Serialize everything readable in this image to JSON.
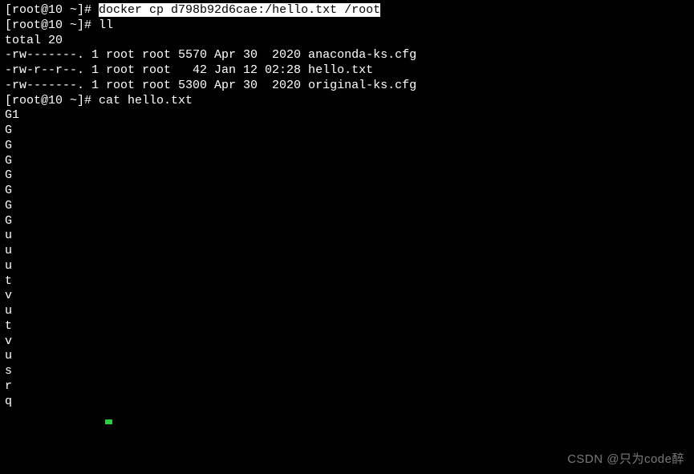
{
  "lines": [
    {
      "prompt": "[root@10 ~]# ",
      "command": "docker cp d798b92d6cae:/hello.txt /root",
      "highlighted": true
    },
    {
      "prompt": "[root@10 ~]# ",
      "command": "ll"
    },
    {
      "text": "total 20"
    },
    {
      "text": "-rw-------. 1 root root 5570 Apr 30  2020 anaconda-ks.cfg"
    },
    {
      "text": "-rw-r--r--. 1 root root   42 Jan 12 02:28 hello.txt"
    },
    {
      "text": "-rw-------. 1 root root 5300 Apr 30  2020 original-ks.cfg"
    },
    {
      "prompt": "[root@10 ~]# ",
      "command": "cat hello.txt"
    },
    {
      "text": "G1"
    },
    {
      "text": "G"
    },
    {
      "text": "G"
    },
    {
      "text": "G"
    },
    {
      "text": "G"
    },
    {
      "text": "G"
    },
    {
      "text": "G"
    },
    {
      "text": "G"
    },
    {
      "text": "u"
    },
    {
      "text": "u"
    },
    {
      "text": "u"
    },
    {
      "text": "t"
    },
    {
      "text": "v"
    },
    {
      "text": "u"
    },
    {
      "text": "t"
    },
    {
      "text": "v"
    },
    {
      "text": "u"
    },
    {
      "text": "s"
    },
    {
      "text": "r"
    },
    {
      "text": "q"
    }
  ],
  "watermark": "CSDN @只为code醉"
}
